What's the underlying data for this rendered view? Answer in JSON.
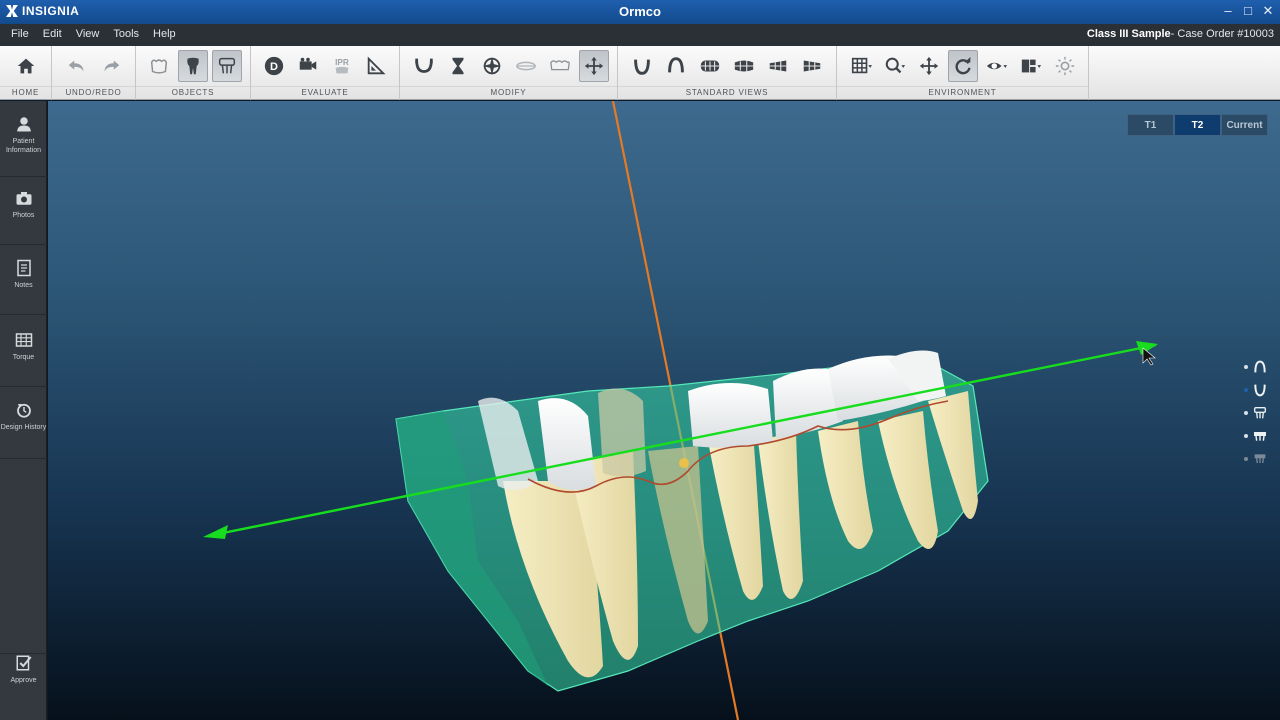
{
  "titlebar": {
    "brand": "INSIGNIA",
    "title": "Ormco"
  },
  "menubar": {
    "items": [
      "File",
      "Edit",
      "View",
      "Tools",
      "Help"
    ],
    "case_name": "Class III Sample",
    "case_order": "- Case Order #10003"
  },
  "toolbar": {
    "groups": [
      "HOME",
      "UNDO/REDO",
      "OBJECTS",
      "EVALUATE",
      "MODIFY",
      "STANDARD VIEWS",
      "ENVIRONMENT"
    ],
    "ipr_label": "IPR"
  },
  "sidebar": {
    "items": [
      "Patient Information",
      "Photos",
      "Notes",
      "Torque",
      "Design History"
    ],
    "approve": "Approve"
  },
  "viewport": {
    "timepoints": [
      "T1",
      "T2",
      "Current"
    ],
    "active_timepoint": "T2"
  }
}
